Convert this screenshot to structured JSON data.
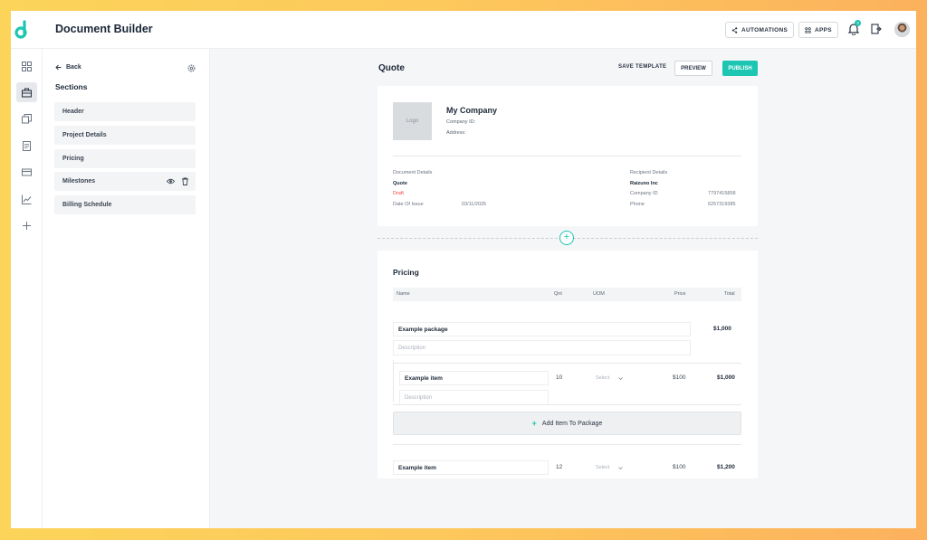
{
  "app": {
    "title": "Document Builder"
  },
  "topbar": {
    "automations_label": "AUTOMATIONS",
    "apps_label": "APPS",
    "notification_count": "3"
  },
  "sections_panel": {
    "back_label": "Back",
    "title": "Sections",
    "items": [
      {
        "label": "Header"
      },
      {
        "label": "Project Details"
      },
      {
        "label": "Pricing"
      },
      {
        "label": "Milestones"
      },
      {
        "label": "Billing Schedule"
      }
    ]
  },
  "main": {
    "title": "Quote",
    "save_template_label": "SAVE TEMPLATE",
    "preview_label": "PREVIEW",
    "publish_label": "PUBLISH"
  },
  "header_card": {
    "logo_label": "Logo",
    "company_name": "My Company",
    "company_id_label": "Company ID:",
    "address_label": "Address:",
    "document_details_label": "Document Details",
    "doc_type": "Quote",
    "doc_status": "Draft",
    "date_of_issue_label": "Date Of Issue",
    "date_of_issue": "03/11/2025",
    "recipient_details_label": "Recipient Details",
    "recipient_name": "Raizuno Inc",
    "recipient_company_id_label": "Company ID",
    "recipient_company_id": "7797415858",
    "recipient_phone_label": "Phone",
    "recipient_phone": "6257319385"
  },
  "pricing": {
    "title": "Pricing",
    "columns": {
      "name": "Name",
      "qnt": "Qnt",
      "uom": "UOM",
      "price": "Price",
      "total": "Total"
    },
    "package": {
      "name": "Example package",
      "description_placeholder": "Description",
      "total": "$1,000"
    },
    "package_item": {
      "name": "Example item",
      "description_placeholder": "Description",
      "qnt": "10",
      "uom": "Select",
      "price": "$100",
      "total": "$1,000"
    },
    "add_item_label": "Add Item To Package",
    "item": {
      "name": "Example item",
      "qnt": "12",
      "uom": "Select",
      "price": "$100",
      "total": "$1,200"
    }
  },
  "colors": {
    "accent": "#1dc6b3",
    "draft": "#ef4444"
  }
}
